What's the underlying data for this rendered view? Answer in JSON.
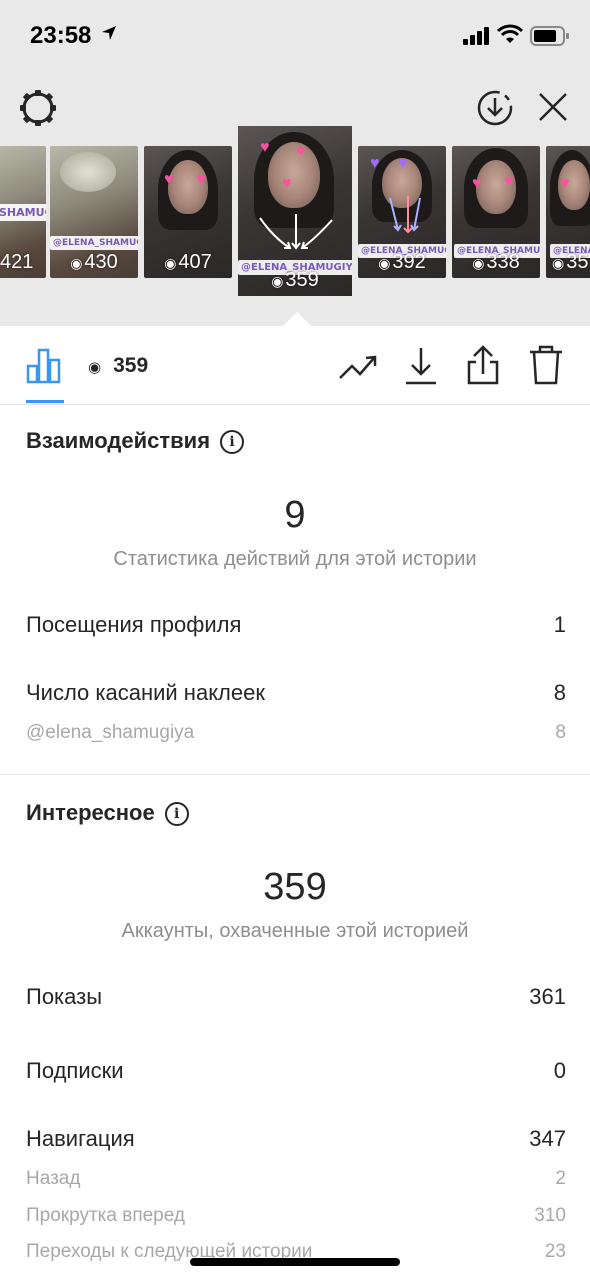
{
  "status_bar": {
    "time": "23:58"
  },
  "stories": [
    {
      "views": "421",
      "tag": "SHAMUGIYA"
    },
    {
      "views": "430",
      "tag": "@ELENA_SHAMUGIYA"
    },
    {
      "views": "407",
      "tag": ""
    },
    {
      "views": "359",
      "tag": "@ELENA_SHAMUGIYA"
    },
    {
      "views": "392",
      "tag": "@ELENA_SHAMUGIYA"
    },
    {
      "views": "338",
      "tag": "@ELENA_SHAMUGIYA"
    },
    {
      "views": "35",
      "tag": "@ELENA"
    }
  ],
  "action_bar": {
    "view_count": "359"
  },
  "interactions": {
    "title": "Взаимодействия",
    "total": "9",
    "caption": "Статистика действий для этой истории",
    "rows": [
      {
        "label": "Посещения профиля",
        "value": "1"
      },
      {
        "label": "Число касаний наклеек",
        "value": "8"
      }
    ],
    "sub_rows": [
      {
        "label": "@elena_shamugiya",
        "value": "8"
      }
    ]
  },
  "discovery": {
    "title": "Интересное",
    "total": "359",
    "caption": "Аккаунты, охваченные этой историей",
    "rows": [
      {
        "label": "Показы",
        "value": "361"
      },
      {
        "label": "Подписки",
        "value": "0"
      },
      {
        "label": "Навигация",
        "value": "347"
      }
    ],
    "sub_rows": [
      {
        "label": "Назад",
        "value": "2"
      },
      {
        "label": "Прокрутка вперед",
        "value": "310"
      },
      {
        "label": "Переходы к следующей истории",
        "value": "23"
      }
    ]
  },
  "colors": {
    "accent": "#3897f0",
    "text": "#262626",
    "secondary": "#8e8e8e",
    "heart": "#ff4fa0"
  },
  "icons": [
    "gear-icon",
    "download-circle-icon",
    "close-icon",
    "bar-chart-icon",
    "eye-icon",
    "trend-icon",
    "download-icon",
    "share-icon",
    "trash-icon",
    "info-icon"
  ]
}
